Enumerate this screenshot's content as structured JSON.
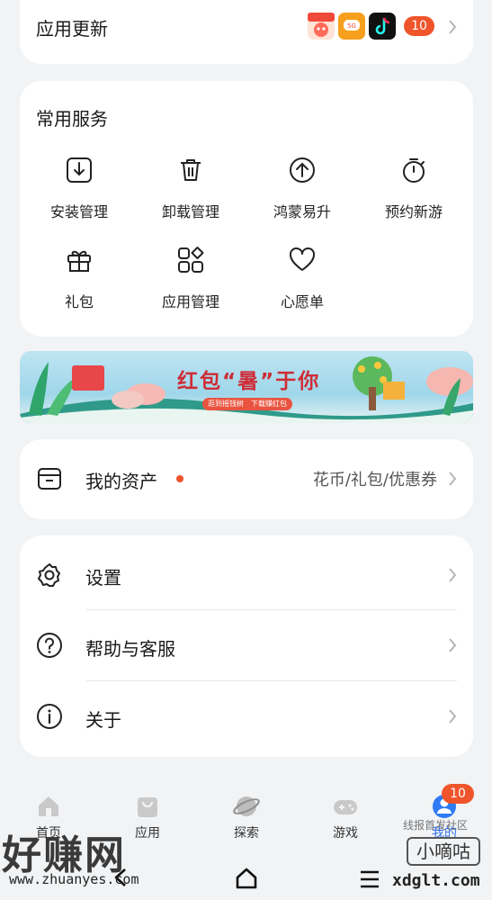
{
  "updates": {
    "title": "应用更新",
    "count": "10",
    "icons": [
      "app-icon-1",
      "app-icon-2",
      "douyin-icon"
    ]
  },
  "services": {
    "title": "常用服务",
    "items": [
      {
        "label": "安装管理",
        "icon": "download-box-icon"
      },
      {
        "label": "卸载管理",
        "icon": "trash-icon"
      },
      {
        "label": "鸿蒙易升",
        "icon": "upgrade-arrow-icon"
      },
      {
        "label": "预约新游",
        "icon": "stopwatch-icon"
      },
      {
        "label": "礼包",
        "icon": "gift-icon"
      },
      {
        "label": "应用管理",
        "icon": "apps-grid-icon"
      },
      {
        "label": "心愿单",
        "icon": "heart-icon"
      }
    ]
  },
  "banner": {
    "title": "红包“暑”于你",
    "subtitle": "逛到摇钱树　下载赚红包"
  },
  "assets": {
    "label": "我的资产",
    "right": "花币/礼包/优惠券"
  },
  "settings": {
    "items": [
      {
        "label": "设置",
        "icon": "gear-icon"
      },
      {
        "label": "帮助与客服",
        "icon": "help-icon"
      },
      {
        "label": "关于",
        "icon": "info-icon"
      }
    ]
  },
  "nav": {
    "items": [
      {
        "label": "首页",
        "icon": "home-icon"
      },
      {
        "label": "应用",
        "icon": "bag-icon"
      },
      {
        "label": "探索",
        "icon": "planet-icon"
      },
      {
        "label": "游戏",
        "icon": "gamepad-icon"
      },
      {
        "label": "我的",
        "icon": "avatar-icon"
      }
    ],
    "badge": "10"
  },
  "watermarks": {
    "left_big": "好赚网",
    "left_url": "www.zhuanyes.com",
    "right_top": "线报首发社区",
    "right_box": "小嘀咕",
    "right_url": "xdglt.com"
  },
  "colors": {
    "accent": "#f0542a",
    "card": "#ffffff",
    "background": "#f1f3f5"
  }
}
